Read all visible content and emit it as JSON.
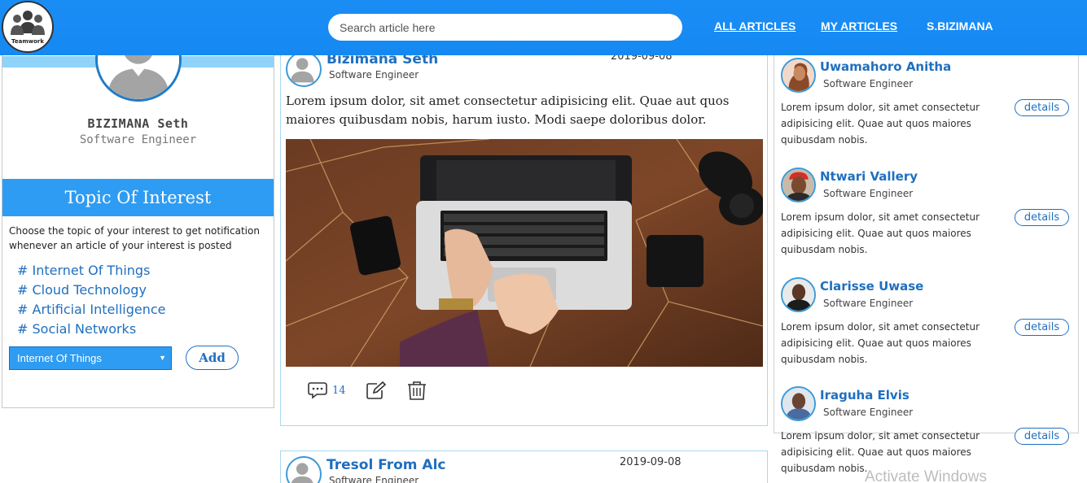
{
  "header": {
    "logo_text": "Teamwork",
    "search_placeholder": "Search article here",
    "nav": {
      "all_articles": "ALL ARTICLES",
      "my_articles": "MY ARTICLES",
      "user": "S.BIZIMANA"
    }
  },
  "profile": {
    "name": "BIZIMANA Seth",
    "role": "Software Engineer"
  },
  "topics": {
    "title": "Topic Of Interest",
    "description": "Choose the topic of your interest to get notification whenever an article of your interest is posted",
    "items": [
      "# Internet Of Things",
      "# Cloud Technology",
      "# Artificial Intelligence",
      "# Social Networks"
    ],
    "select_value": "Internet Of Things",
    "add_label": "Add"
  },
  "articles": [
    {
      "author": "Bizimana Seth",
      "role": "Software Engineer",
      "date": "2019-09-08",
      "body": "Lorem ipsum dolor, sit amet consectetur adipisicing elit. Quae aut quos maiores quibusdam nobis, harum iusto. Modi saepe doloribus dolor.",
      "comment_count": "14"
    },
    {
      "author": "Tresol From Alc",
      "role": "Software Engineer",
      "date": "2019-09-08"
    }
  ],
  "people": [
    {
      "name": "Uwamahoro Anitha",
      "role": "Software Engineer",
      "text": "Lorem ipsum dolor, sit amet consectetur adipisicing elit. Quae aut quos maiores quibusdam nobis.",
      "details_label": "details"
    },
    {
      "name": "Ntwari Vallery",
      "role": "Software Engineer",
      "text": "Lorem ipsum dolor, sit amet consectetur adipisicing elit. Quae aut quos maiores quibusdam nobis.",
      "details_label": "details"
    },
    {
      "name": "Clarisse Uwase",
      "role": "Software Engineer",
      "text": "Lorem ipsum dolor, sit amet consectetur adipisicing elit. Quae aut quos maiores quibusdam nobis.",
      "details_label": "details"
    },
    {
      "name": "Iraguha Elvis",
      "role": "Software Engineer",
      "text": "Lorem ipsum dolor, sit amet consectetur adipisicing elit. Quae aut quos maiores quibusdam nobis.",
      "details_label": "details"
    }
  ],
  "watermark": "Activate Windows",
  "colors": {
    "header_blue": "#1589f2",
    "accent_blue": "#1f6fbf",
    "topic_header": "#2e9cf2",
    "profile_band": "#8fd3fb"
  },
  "icons": [
    "team-logo-icon",
    "comment-icon",
    "edit-icon",
    "trash-icon"
  ]
}
